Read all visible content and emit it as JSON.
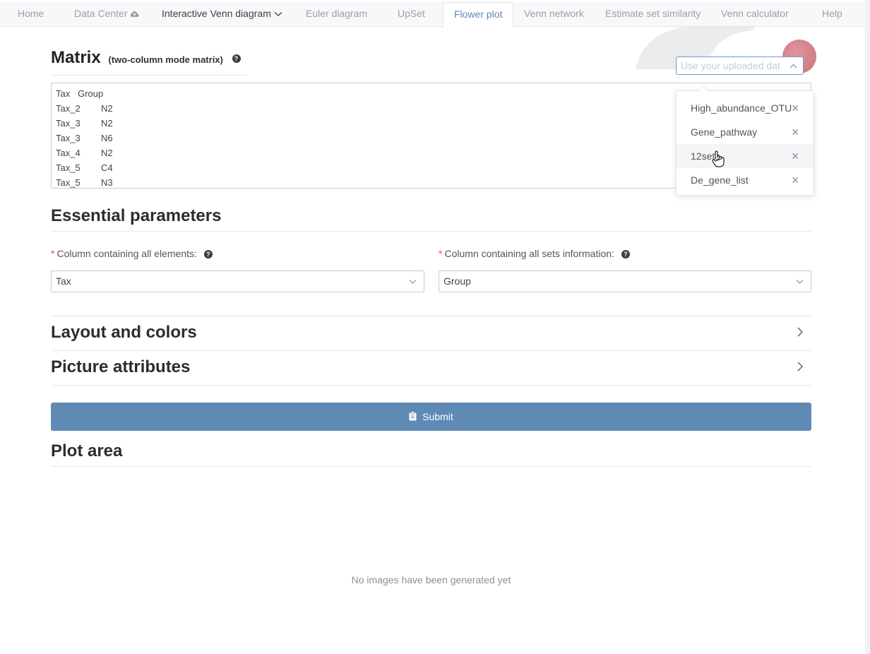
{
  "nav": {
    "items": [
      {
        "label": "Home"
      },
      {
        "label": "Data Center"
      },
      {
        "label": "Interactive Venn diagram"
      },
      {
        "label": "Euler diagram"
      },
      {
        "label": "UpSet"
      },
      {
        "label": "Flower plot"
      },
      {
        "label": "Venn network"
      },
      {
        "label": "Estimate set similarity"
      },
      {
        "label": "Venn calculator"
      },
      {
        "label": "Help"
      }
    ],
    "active": "Flower plot"
  },
  "matrix": {
    "title": "Matrix",
    "subtitle": "(two-column mode matrix)",
    "help": "?",
    "rows": [
      [
        "Tax",
        "Group"
      ],
      [
        "Tax_2",
        "N2"
      ],
      [
        "Tax_3",
        "N2"
      ],
      [
        "Tax_3",
        "N6"
      ],
      [
        "Tax_4",
        "N2"
      ],
      [
        "Tax_5",
        "C4"
      ],
      [
        "Tax_5",
        "N3"
      ]
    ]
  },
  "uploaded_select": {
    "placeholder": "Use your uploaded dat",
    "options": [
      {
        "label": "High_abundance_OTU"
      },
      {
        "label": "Gene_pathway"
      },
      {
        "label": "12sets"
      },
      {
        "label": "De_gene_list"
      }
    ],
    "hovered": "12sets"
  },
  "essential": {
    "title": "Essential parameters",
    "elements_label": "Column containing all elements:",
    "elements_value": "Tax",
    "sets_label": "Column containing all sets information:",
    "sets_value": "Group",
    "required_mark": "*"
  },
  "layout_colors": {
    "title": "Layout and colors"
  },
  "picture_attributes": {
    "title": "Picture attributes"
  },
  "submit": {
    "label": "Submit"
  },
  "plot_area": {
    "title": "Plot area",
    "empty_text": "No images have been generated yet"
  },
  "colors": {
    "accent": "#5f8ab5",
    "active_tab": "#5b8ab8",
    "required": "#e4524c"
  }
}
